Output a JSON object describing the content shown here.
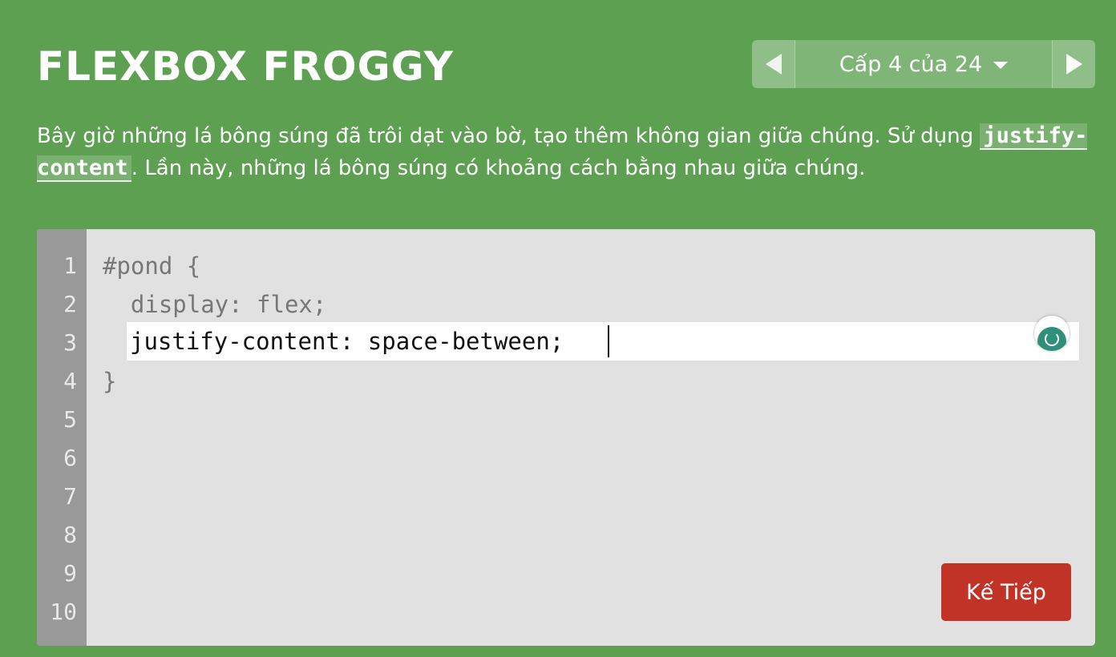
{
  "header": {
    "title": "FLEXBOX FROGGY"
  },
  "level_nav": {
    "level_label": "Cấp 4 của 24",
    "prev_icon": "triangle-left-icon",
    "next_icon": "triangle-right-icon",
    "dropdown_icon": "caret-down-icon"
  },
  "instructions": {
    "text_before": "Bây giờ những lá bông súng đã trôi dạt vào bờ, tạo thêm không gian giữa chúng. Sử dụng ",
    "code_term": "justify-content",
    "text_after": ". Lần này, những lá bông súng có khoảng cách bằng nhau giữa chúng."
  },
  "editor": {
    "line_numbers": [
      "1",
      "2",
      "3",
      "4",
      "5",
      "6",
      "7",
      "8",
      "9",
      "10"
    ],
    "line_1": "#pond {",
    "line_2": "  display: flex;",
    "input_value": "justify-content: space-between;",
    "line_4": "}",
    "grammarly_icon": "grammarly-icon",
    "next_button_label": "Kế Tiếp"
  },
  "colors": {
    "background": "#5da052",
    "editor_bg": "#e1e1e1",
    "gutter_bg": "#999999",
    "next_button": "#c23327"
  }
}
